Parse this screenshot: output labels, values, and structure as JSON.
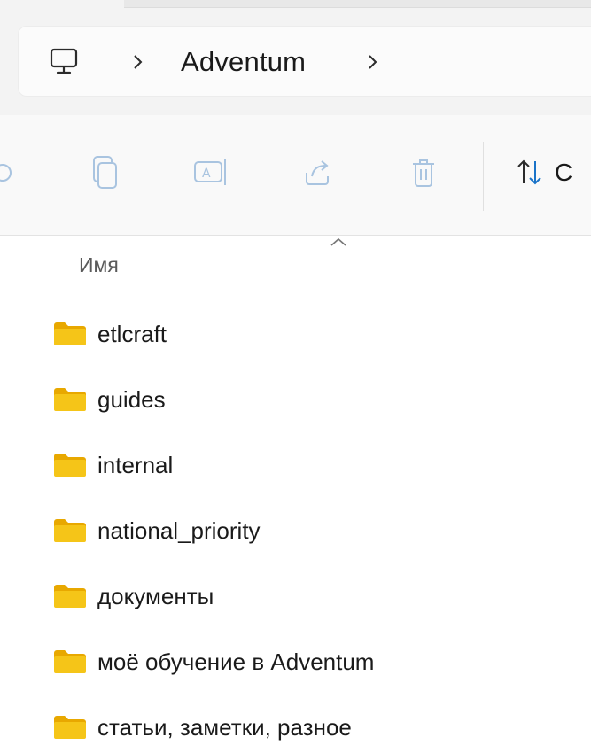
{
  "breadcrumb": {
    "root_icon": "this-pc-icon",
    "items": [
      "Adventum"
    ]
  },
  "toolbar": {
    "buttons": [
      {
        "name": "copy-button",
        "icon": "copy-icon"
      },
      {
        "name": "paste-button",
        "icon": "paste-icon"
      },
      {
        "name": "rename-button",
        "icon": "rename-icon"
      },
      {
        "name": "share-button",
        "icon": "share-icon"
      },
      {
        "name": "delete-button",
        "icon": "trash-icon"
      }
    ],
    "sort_label": "С"
  },
  "columns": {
    "name": "Имя"
  },
  "files": [
    {
      "name": "etlcraft",
      "type": "folder"
    },
    {
      "name": "guides",
      "type": "folder"
    },
    {
      "name": "internal",
      "type": "folder"
    },
    {
      "name": "national_priority",
      "type": "folder"
    },
    {
      "name": "документы",
      "type": "folder"
    },
    {
      "name": "моё обучение в Adventum",
      "type": "folder"
    },
    {
      "name": "статьи, заметки, разное",
      "type": "folder"
    }
  ],
  "colors": {
    "folder": "#f5c518",
    "folder_dark": "#e8a800",
    "accent_blue": "#1a73c8",
    "disabled_icon": "#a9c4e0"
  }
}
